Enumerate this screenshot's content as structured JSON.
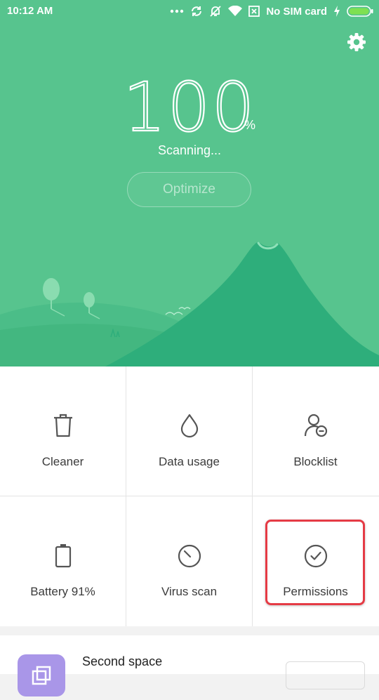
{
  "status_bar": {
    "time": "10:12 AM",
    "carrier": "No SIM card",
    "icons": [
      "more-dots-icon",
      "sync-icon",
      "alarm-off-icon",
      "wifi-icon",
      "sim-off-icon",
      "charging-icon",
      "battery-icon"
    ]
  },
  "hero": {
    "score": "100",
    "unit": "%",
    "status": "Scanning...",
    "optimize_label": "Optimize",
    "accent": "#57c48e",
    "mountain_color": "#2eae7b"
  },
  "tiles": [
    {
      "label": "Cleaner",
      "icon": "trash-icon"
    },
    {
      "label": "Data usage",
      "icon": "drop-icon"
    },
    {
      "label": "Blocklist",
      "icon": "person-block-icon"
    },
    {
      "label": "Battery 91%",
      "icon": "battery-icon"
    },
    {
      "label": "Virus scan",
      "icon": "scan-icon"
    },
    {
      "label": "Permissions",
      "icon": "check-circle-icon"
    }
  ],
  "highlight_color": "#e53b45",
  "second_space": {
    "title": "Second space",
    "icon": "second-space-icon",
    "icon_color": "#a996e8"
  }
}
